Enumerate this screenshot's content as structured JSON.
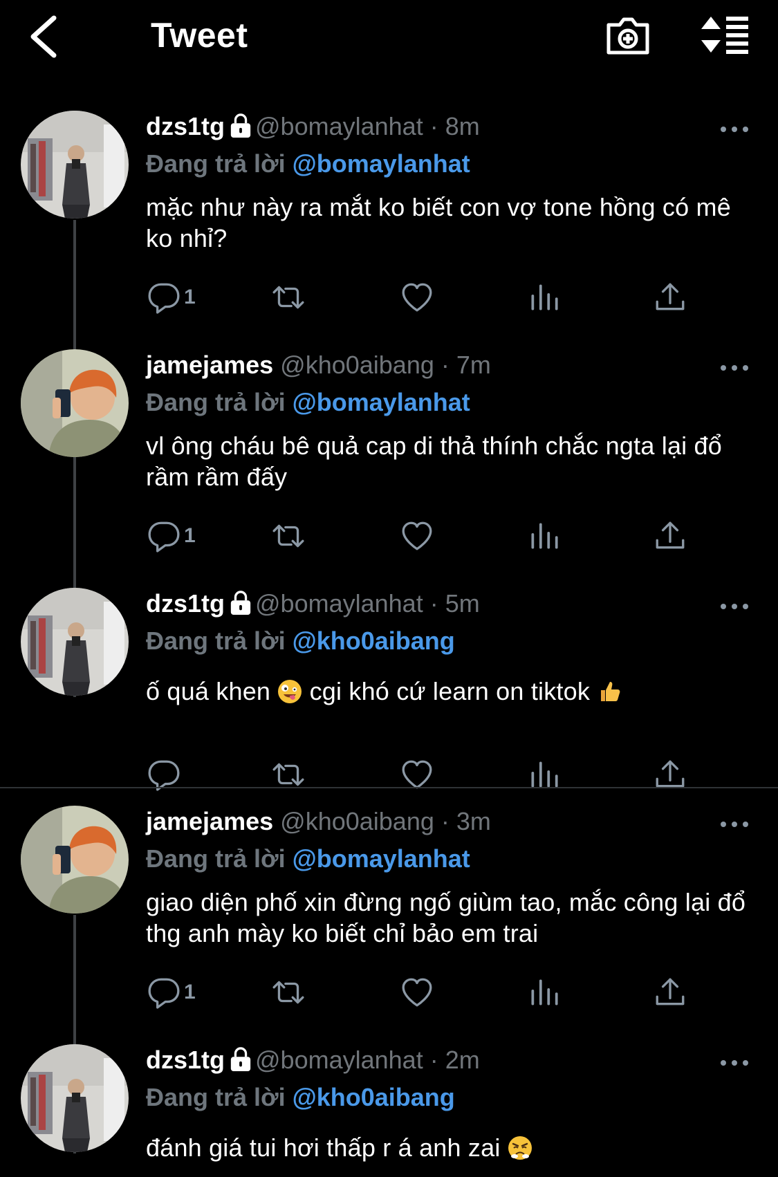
{
  "header": {
    "title": "Tweet"
  },
  "colors": {
    "background": "#000000",
    "link": "#4a99e9",
    "muted": "#71767b"
  },
  "tweets": [
    {
      "name": "dzs1tg",
      "locked": true,
      "handle": "@bomaylanhat",
      "sep": "·",
      "time": "8m",
      "reply_label": "Đang trả lời",
      "reply_to": "@bomaylanhat",
      "text": "mặc như này ra mắt ko biết con vợ tone hồng có mê ko nhỉ?",
      "reply_count": "1"
    },
    {
      "name": "jamejames",
      "locked": false,
      "handle": "@kho0aibang",
      "sep": "·",
      "time": "7m",
      "reply_label": "Đang trả lời",
      "reply_to": "@bomaylanhat",
      "text": "vl ông cháu bê quả cap di thả thính chắc ngta lại đổ rầm rầm đấy",
      "reply_count": "1"
    },
    {
      "name": "dzs1tg",
      "locked": true,
      "handle": "@bomaylanhat",
      "sep": "·",
      "time": "5m",
      "reply_label": "Đang trả lời",
      "reply_to": "@kho0aibang",
      "text_a": "ố quá khen",
      "emoji_a": "zany-face-emoji",
      "text_b": "cgi khó cứ learn on tiktok",
      "emoji_b": "thumbs-up-emoji",
      "reply_count": ""
    },
    {
      "name": "jamejames",
      "locked": false,
      "handle": "@kho0aibang",
      "sep": "·",
      "time": "3m",
      "reply_label": "Đang trả lời",
      "reply_to": "@bomaylanhat",
      "text": "giao diện phố xin đừng ngố giùm tao, mắc công lại đổ thg anh mày ko biết chỉ bảo em trai",
      "reply_count": "1"
    },
    {
      "name": "dzs1tg",
      "locked": true,
      "handle": "@bomaylanhat",
      "sep": "·",
      "time": "2m",
      "reply_label": "Đang trả lời",
      "reply_to": "@kho0aibang",
      "text_a": "đánh giá tui hơi thấp r á anh zai",
      "emoji_a": "steam-nose-emoji"
    }
  ]
}
